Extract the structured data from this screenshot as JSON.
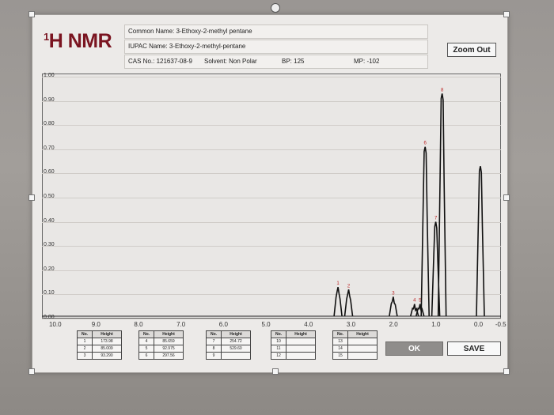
{
  "header": {
    "title": "H NMR",
    "title_superscript": "1",
    "common_name": "Common Name:  3-Ethoxy-2-methyl pentane",
    "iupac_name": "IUPAC Name:  3-Ethoxy-2-methyl-pentane",
    "cas": "CAS No.: 121637-08-9",
    "solvent": "Solvent: Non Polar",
    "bp": "BP: 125",
    "mp": "MP: -102"
  },
  "toolbar": {
    "zoom_out_label": "Zoom Out",
    "ok_label": "OK",
    "save_label": "SAVE"
  },
  "axes": {
    "y_ticks": [
      "1.00",
      "0.90",
      "0.80",
      "0.70",
      "0.60",
      "0.50",
      "0.40",
      "0.30",
      "0.20",
      "0.10",
      "0.00"
    ],
    "x_ticks": [
      "10.0",
      "9.0",
      "8.0",
      "7.0",
      "6.0",
      "5.0",
      "4.0",
      "3.0",
      "2.0",
      "1.0",
      "0.0",
      "-0.5"
    ]
  },
  "peak_tables": [
    {
      "headers": [
        "No.",
        "Height"
      ],
      "rows": [
        [
          "1",
          "173.98"
        ],
        [
          "2",
          "85.009"
        ],
        [
          "3",
          "93.290"
        ]
      ]
    },
    {
      "headers": [
        "No.",
        "Height"
      ],
      "rows": [
        [
          "4",
          "85.659"
        ],
        [
          "5",
          "92.975"
        ],
        [
          "6",
          "297.56"
        ]
      ]
    },
    {
      "headers": [
        "No.",
        "Height"
      ],
      "rows": [
        [
          "7",
          "254.72"
        ],
        [
          "8",
          "529.60"
        ],
        [
          "9",
          ""
        ]
      ]
    },
    {
      "headers": [
        "No.",
        "Height"
      ],
      "rows": [
        [
          "10",
          ""
        ],
        [
          "11",
          ""
        ],
        [
          "12",
          ""
        ]
      ]
    },
    {
      "headers": [
        "No.",
        "Height"
      ],
      "rows": [
        [
          "13",
          ""
        ],
        [
          "14",
          ""
        ],
        [
          "15",
          ""
        ]
      ]
    }
  ],
  "chart_data": {
    "type": "line",
    "xlabel": "",
    "ylabel": "",
    "xlim": [
      10.0,
      -0.5
    ],
    "ylim": [
      0.0,
      1.0
    ],
    "grid": true,
    "peaks": [
      {
        "label": "1",
        "x": 3.35,
        "y": 0.13
      },
      {
        "label": "2",
        "x": 3.1,
        "y": 0.12
      },
      {
        "label": "3",
        "x": 2.05,
        "y": 0.09
      },
      {
        "label": "4",
        "x": 1.55,
        "y": 0.06
      },
      {
        "label": "5",
        "x": 1.42,
        "y": 0.06
      },
      {
        "label": "6",
        "x": 1.3,
        "y": 0.71
      },
      {
        "label": "7",
        "x": 1.05,
        "y": 0.4
      },
      {
        "label": "8",
        "x": 0.9,
        "y": 0.93
      },
      {
        "label": "",
        "x": 0.0,
        "y": 0.63
      }
    ]
  }
}
